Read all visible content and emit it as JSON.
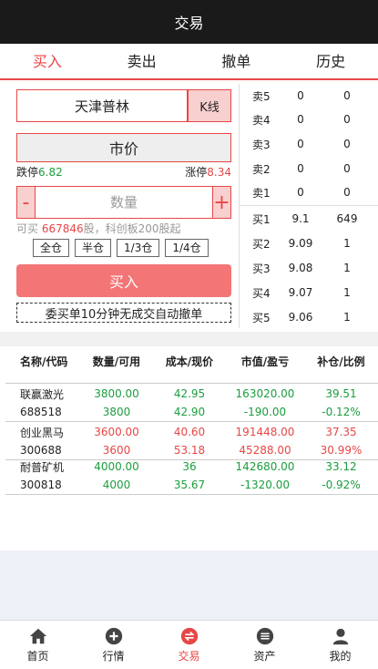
{
  "header": {
    "title": "交易"
  },
  "tabs": [
    {
      "label": "买入",
      "active": true
    },
    {
      "label": "卖出",
      "active": false
    },
    {
      "label": "撤单",
      "active": false
    },
    {
      "label": "历史",
      "active": false
    }
  ],
  "order": {
    "stock_name": "天津普林",
    "kline_label": "K线",
    "price_mode": "市价",
    "limit_down_label": "跌停",
    "limit_down_value": "6.82",
    "limit_up_label": "涨停",
    "limit_up_value": "8.34",
    "minus_label": "-",
    "plus_label": "+",
    "qty_placeholder": "数量",
    "avail_prefix": "可买 ",
    "avail_value": "667846",
    "avail_suffix": "股，科创板200股起",
    "positions": [
      "全仓",
      "半仓",
      "1/3仓",
      "1/4仓"
    ],
    "buy_button": "买入",
    "notice": "委买单10分钟无成交自动撤单"
  },
  "order_book": {
    "sell": [
      {
        "label": "卖5",
        "price": "0",
        "volume": "0"
      },
      {
        "label": "卖4",
        "price": "0",
        "volume": "0"
      },
      {
        "label": "卖3",
        "price": "0",
        "volume": "0"
      },
      {
        "label": "卖2",
        "price": "0",
        "volume": "0"
      },
      {
        "label": "卖1",
        "price": "0",
        "volume": "0"
      }
    ],
    "buy": [
      {
        "label": "买1",
        "price": "9.1",
        "volume": "649"
      },
      {
        "label": "买2",
        "price": "9.09",
        "volume": "1"
      },
      {
        "label": "买3",
        "price": "9.08",
        "volume": "1"
      },
      {
        "label": "买4",
        "price": "9.07",
        "volume": "1"
      },
      {
        "label": "买5",
        "price": "9.06",
        "volume": "1"
      }
    ]
  },
  "holdings": {
    "headers": [
      "名称/代码",
      "数量/可用",
      "成本/现价",
      "市值/盈亏",
      "补仓/比例"
    ],
    "rows": [
      {
        "name": "联赢激光",
        "code": "688518",
        "qty": "3800.00",
        "avail": "3800",
        "cost": "42.95",
        "price": "42.90",
        "value": "163020.00",
        "pnl": "-190.00",
        "add": "39.51",
        "ratio": "-0.12%",
        "pnl_color": "green"
      },
      {
        "name": "创业黑马",
        "code": "300688",
        "qty": "3600.00",
        "avail": "3600",
        "cost": "40.60",
        "price": "53.18",
        "value": "191448.00",
        "pnl": "45288.00",
        "add": "37.35",
        "ratio": "30.99%",
        "pnl_color": "red"
      },
      {
        "name": "耐普矿机",
        "code": "300818",
        "qty": "4000.00",
        "avail": "4000",
        "cost": "36",
        "price": "35.67",
        "value": "142680.00",
        "pnl": "-1320.00",
        "add": "33.12",
        "ratio": "-0.92%",
        "pnl_color": "green"
      }
    ]
  },
  "bottom_nav": [
    {
      "label": "首页",
      "icon": "home-icon",
      "active": false
    },
    {
      "label": "行情",
      "icon": "plus-circle-icon",
      "active": false
    },
    {
      "label": "交易",
      "icon": "trade-icon",
      "active": true
    },
    {
      "label": "资产",
      "icon": "wallet-icon",
      "active": false
    },
    {
      "label": "我的",
      "icon": "user-icon",
      "active": false
    }
  ],
  "colors": {
    "accent": "#e84646",
    "green": "#1b9e3e",
    "header_bg": "#1a1a1a",
    "buy_button": "#f47575"
  }
}
